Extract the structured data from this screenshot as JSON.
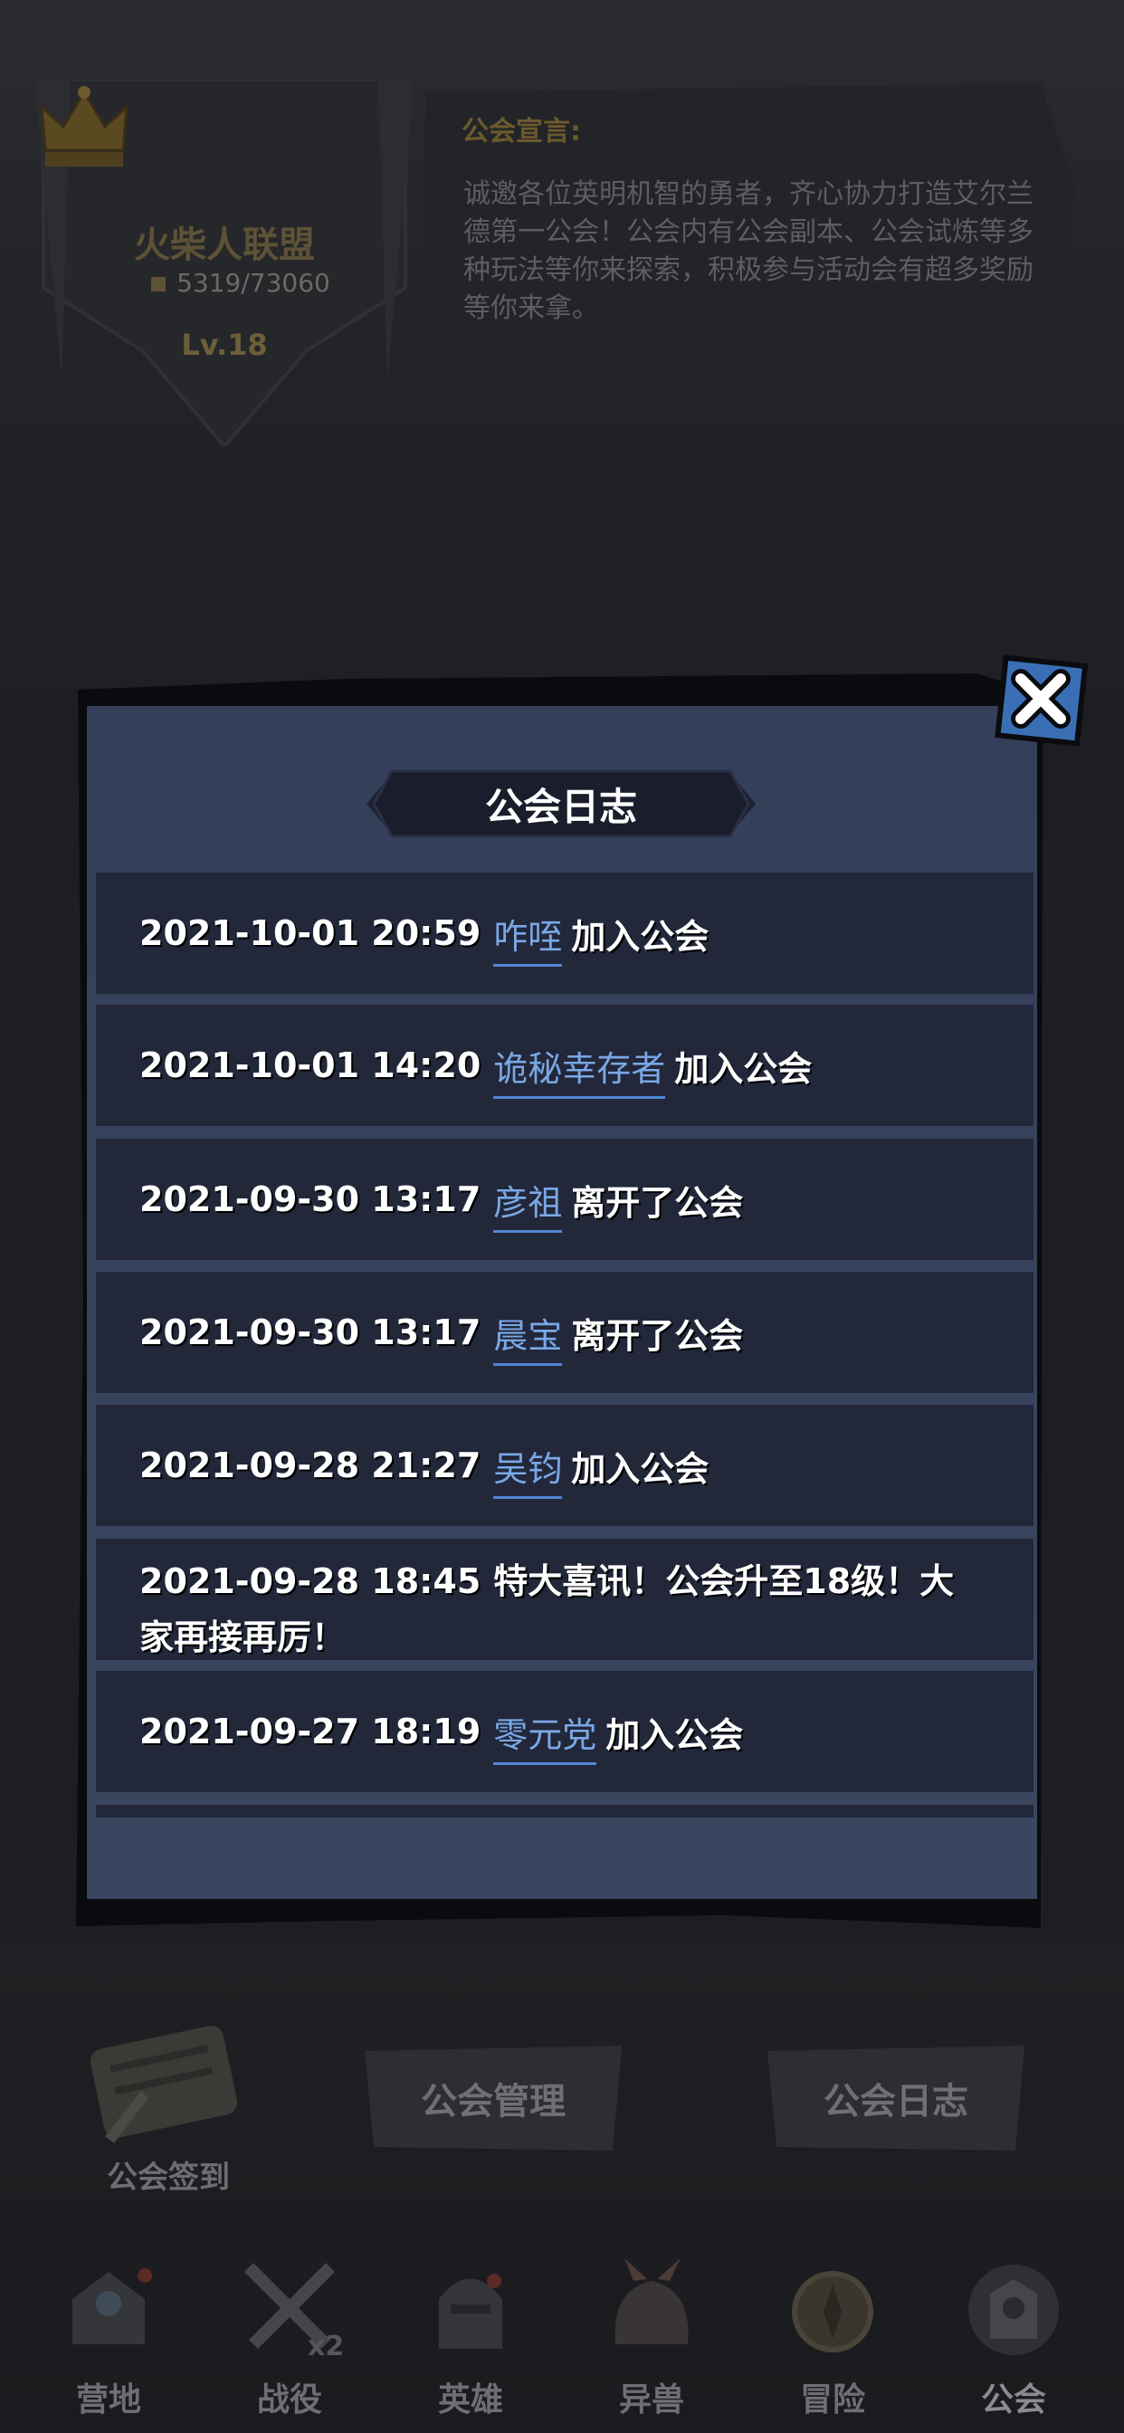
{
  "guild": {
    "name": "火柴人联盟",
    "exp": "5319/73060",
    "level": "Lv.18",
    "declaration_title": "公会宣言:",
    "declaration_text": "诚邀各位英明机智的勇者，齐心协力打造艾尔兰德第一公会！公会内有公会副本、公会试炼等多种玩法等你来探索，积极参与活动会有超多奖励等你来拿。"
  },
  "modal": {
    "title": "公会日志",
    "close_icon": "close-x-icon",
    "entries": [
      {
        "time": "2021-10-01 20:59",
        "name": "咋咥",
        "action": "加入公会"
      },
      {
        "time": "2021-10-01 14:20",
        "name": "诡秘幸存者",
        "action": "加入公会"
      },
      {
        "time": "2021-09-30 13:17",
        "name": "彦祖",
        "action": "离开了公会"
      },
      {
        "time": "2021-09-30 13:17",
        "name": "晨宝",
        "action": "离开了公会"
      },
      {
        "time": "2021-09-28 21:27",
        "name": "吴钧",
        "action": "加入公会"
      },
      {
        "time": "2021-09-28 18:45",
        "text_line1": "特大喜讯！公会升至18级！大",
        "text_line2": "家再接再厉！"
      },
      {
        "time": "2021-09-27 18:19",
        "name": "零元党",
        "action": "加入公会"
      }
    ]
  },
  "actions": {
    "sign_in": "公会签到",
    "manage": "公会管理",
    "log": "公会日志"
  },
  "nav": {
    "items": [
      {
        "label": "营地",
        "icon": "camp-icon"
      },
      {
        "label": "战役",
        "icon": "battle-swords-icon",
        "badge": "x2"
      },
      {
        "label": "英雄",
        "icon": "hero-helmet-icon"
      },
      {
        "label": "异兽",
        "icon": "beast-icon"
      },
      {
        "label": "冒险",
        "icon": "adventure-compass-icon"
      },
      {
        "label": "公会",
        "icon": "guild-icon"
      }
    ],
    "active": "公会"
  },
  "colors": {
    "link_name": "#7aa8e6",
    "row_bg": "#22273a",
    "panel_bg": "#34405a"
  }
}
